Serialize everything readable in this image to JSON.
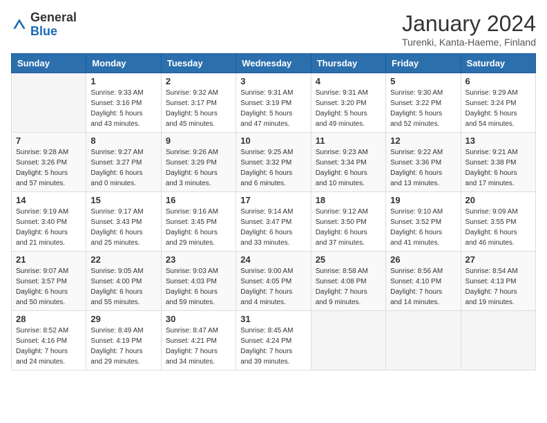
{
  "header": {
    "logo_general": "General",
    "logo_blue": "Blue",
    "title": "January 2024",
    "location": "Turenki, Kanta-Haeme, Finland"
  },
  "weekdays": [
    "Sunday",
    "Monday",
    "Tuesday",
    "Wednesday",
    "Thursday",
    "Friday",
    "Saturday"
  ],
  "weeks": [
    [
      {
        "day": "",
        "info": ""
      },
      {
        "day": "1",
        "info": "Sunrise: 9:33 AM\nSunset: 3:16 PM\nDaylight: 5 hours\nand 43 minutes."
      },
      {
        "day": "2",
        "info": "Sunrise: 9:32 AM\nSunset: 3:17 PM\nDaylight: 5 hours\nand 45 minutes."
      },
      {
        "day": "3",
        "info": "Sunrise: 9:31 AM\nSunset: 3:19 PM\nDaylight: 5 hours\nand 47 minutes."
      },
      {
        "day": "4",
        "info": "Sunrise: 9:31 AM\nSunset: 3:20 PM\nDaylight: 5 hours\nand 49 minutes."
      },
      {
        "day": "5",
        "info": "Sunrise: 9:30 AM\nSunset: 3:22 PM\nDaylight: 5 hours\nand 52 minutes."
      },
      {
        "day": "6",
        "info": "Sunrise: 9:29 AM\nSunset: 3:24 PM\nDaylight: 5 hours\nand 54 minutes."
      }
    ],
    [
      {
        "day": "7",
        "info": "Sunrise: 9:28 AM\nSunset: 3:26 PM\nDaylight: 5 hours\nand 57 minutes."
      },
      {
        "day": "8",
        "info": "Sunrise: 9:27 AM\nSunset: 3:27 PM\nDaylight: 6 hours\nand 0 minutes."
      },
      {
        "day": "9",
        "info": "Sunrise: 9:26 AM\nSunset: 3:29 PM\nDaylight: 6 hours\nand 3 minutes."
      },
      {
        "day": "10",
        "info": "Sunrise: 9:25 AM\nSunset: 3:32 PM\nDaylight: 6 hours\nand 6 minutes."
      },
      {
        "day": "11",
        "info": "Sunrise: 9:23 AM\nSunset: 3:34 PM\nDaylight: 6 hours\nand 10 minutes."
      },
      {
        "day": "12",
        "info": "Sunrise: 9:22 AM\nSunset: 3:36 PM\nDaylight: 6 hours\nand 13 minutes."
      },
      {
        "day": "13",
        "info": "Sunrise: 9:21 AM\nSunset: 3:38 PM\nDaylight: 6 hours\nand 17 minutes."
      }
    ],
    [
      {
        "day": "14",
        "info": "Sunrise: 9:19 AM\nSunset: 3:40 PM\nDaylight: 6 hours\nand 21 minutes."
      },
      {
        "day": "15",
        "info": "Sunrise: 9:17 AM\nSunset: 3:43 PM\nDaylight: 6 hours\nand 25 minutes."
      },
      {
        "day": "16",
        "info": "Sunrise: 9:16 AM\nSunset: 3:45 PM\nDaylight: 6 hours\nand 29 minutes."
      },
      {
        "day": "17",
        "info": "Sunrise: 9:14 AM\nSunset: 3:47 PM\nDaylight: 6 hours\nand 33 minutes."
      },
      {
        "day": "18",
        "info": "Sunrise: 9:12 AM\nSunset: 3:50 PM\nDaylight: 6 hours\nand 37 minutes."
      },
      {
        "day": "19",
        "info": "Sunrise: 9:10 AM\nSunset: 3:52 PM\nDaylight: 6 hours\nand 41 minutes."
      },
      {
        "day": "20",
        "info": "Sunrise: 9:09 AM\nSunset: 3:55 PM\nDaylight: 6 hours\nand 46 minutes."
      }
    ],
    [
      {
        "day": "21",
        "info": "Sunrise: 9:07 AM\nSunset: 3:57 PM\nDaylight: 6 hours\nand 50 minutes."
      },
      {
        "day": "22",
        "info": "Sunrise: 9:05 AM\nSunset: 4:00 PM\nDaylight: 6 hours\nand 55 minutes."
      },
      {
        "day": "23",
        "info": "Sunrise: 9:03 AM\nSunset: 4:03 PM\nDaylight: 6 hours\nand 59 minutes."
      },
      {
        "day": "24",
        "info": "Sunrise: 9:00 AM\nSunset: 4:05 PM\nDaylight: 7 hours\nand 4 minutes."
      },
      {
        "day": "25",
        "info": "Sunrise: 8:58 AM\nSunset: 4:08 PM\nDaylight: 7 hours\nand 9 minutes."
      },
      {
        "day": "26",
        "info": "Sunrise: 8:56 AM\nSunset: 4:10 PM\nDaylight: 7 hours\nand 14 minutes."
      },
      {
        "day": "27",
        "info": "Sunrise: 8:54 AM\nSunset: 4:13 PM\nDaylight: 7 hours\nand 19 minutes."
      }
    ],
    [
      {
        "day": "28",
        "info": "Sunrise: 8:52 AM\nSunset: 4:16 PM\nDaylight: 7 hours\nand 24 minutes."
      },
      {
        "day": "29",
        "info": "Sunrise: 8:49 AM\nSunset: 4:19 PM\nDaylight: 7 hours\nand 29 minutes."
      },
      {
        "day": "30",
        "info": "Sunrise: 8:47 AM\nSunset: 4:21 PM\nDaylight: 7 hours\nand 34 minutes."
      },
      {
        "day": "31",
        "info": "Sunrise: 8:45 AM\nSunset: 4:24 PM\nDaylight: 7 hours\nand 39 minutes."
      },
      {
        "day": "",
        "info": ""
      },
      {
        "day": "",
        "info": ""
      },
      {
        "day": "",
        "info": ""
      }
    ]
  ]
}
